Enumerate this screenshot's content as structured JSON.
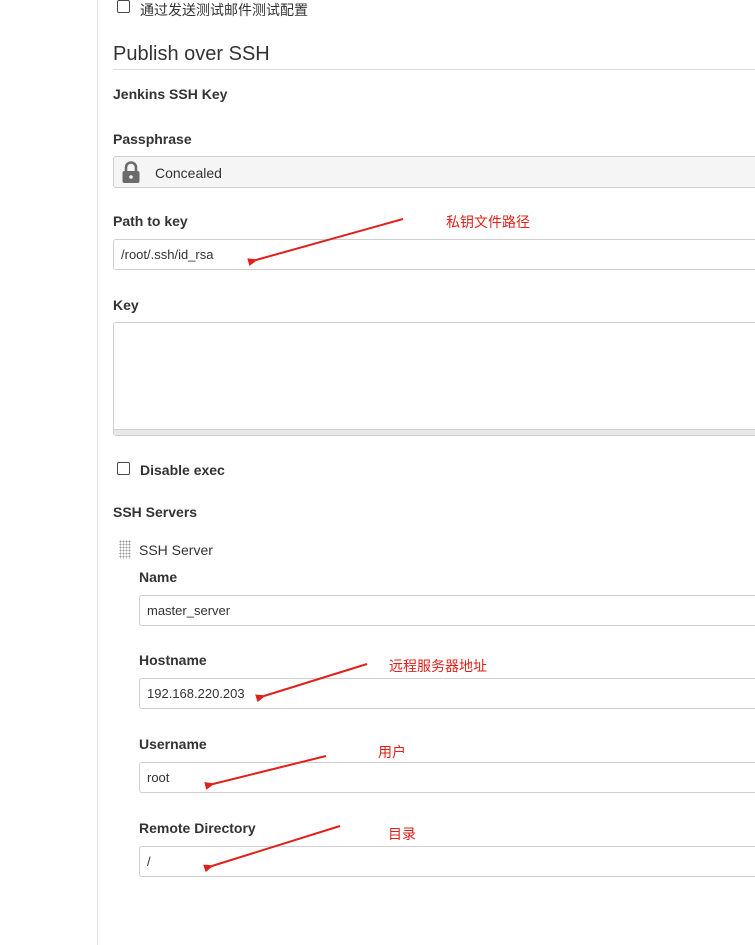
{
  "test_email_checkbox": {
    "label": "通过发送测试邮件测试配置",
    "checked": false
  },
  "section": {
    "title": "Publish over SSH"
  },
  "jenkins_ssh_key": {
    "label": "Jenkins SSH Key"
  },
  "passphrase": {
    "label": "Passphrase",
    "value": "Concealed",
    "icon": "lock-icon"
  },
  "path_to_key": {
    "label": "Path to key",
    "value": "/root/.ssh/id_rsa"
  },
  "key": {
    "label": "Key",
    "value": ""
  },
  "disable_exec": {
    "label": "Disable exec",
    "checked": false
  },
  "ssh_servers": {
    "label": "SSH Servers",
    "server": {
      "header": "SSH Server",
      "name": {
        "label": "Name",
        "value": "master_server"
      },
      "hostname": {
        "label": "Hostname",
        "value": "192.168.220.203"
      },
      "username": {
        "label": "Username",
        "value": "root"
      },
      "remote_directory": {
        "label": "Remote Directory",
        "value": "/"
      }
    }
  },
  "annotations": {
    "path_to_key": "私钥文件路径",
    "hostname": "远程服务器地址",
    "username": "用户",
    "remote_directory": "目录"
  },
  "colors": {
    "annotation": "#e0201a",
    "border": "#cfcfcf",
    "lock": "#6b6b6b"
  }
}
